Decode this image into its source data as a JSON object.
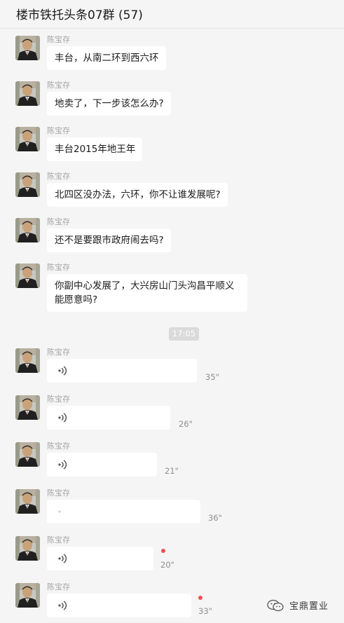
{
  "chat": {
    "title": "楼市铁托头条07群 (57)"
  },
  "sender_name": "陈宝存",
  "text_messages": [
    {
      "text": "丰台，从南二环到西六环"
    },
    {
      "text": "地卖了，下一步该怎么办?"
    },
    {
      "text": "丰台2015年地王年"
    },
    {
      "text": "北四区没办法，六环，你不让谁发展呢?"
    },
    {
      "text": "还不是要跟市政府闹去吗?"
    },
    {
      "text": "你副中心发展了，大兴房山门头沟昌平顺义能愿意吗?"
    }
  ],
  "timestamp": "17:05",
  "voice_messages": [
    {
      "duration": "35\"",
      "unread": false
    },
    {
      "duration": "26\"",
      "unread": false
    },
    {
      "duration": "21\"",
      "unread": false
    },
    {
      "duration": "36\"",
      "unread": false
    },
    {
      "duration": "20\"",
      "unread": true
    },
    {
      "duration": "33\"",
      "unread": true
    }
  ],
  "watermark": {
    "text": "宝鼎置业",
    "icon": "wechat-official-account-icon"
  },
  "colors": {
    "background": "#f5f5f5",
    "bubble": "#ffffff",
    "unread_dot": "#f05050"
  }
}
